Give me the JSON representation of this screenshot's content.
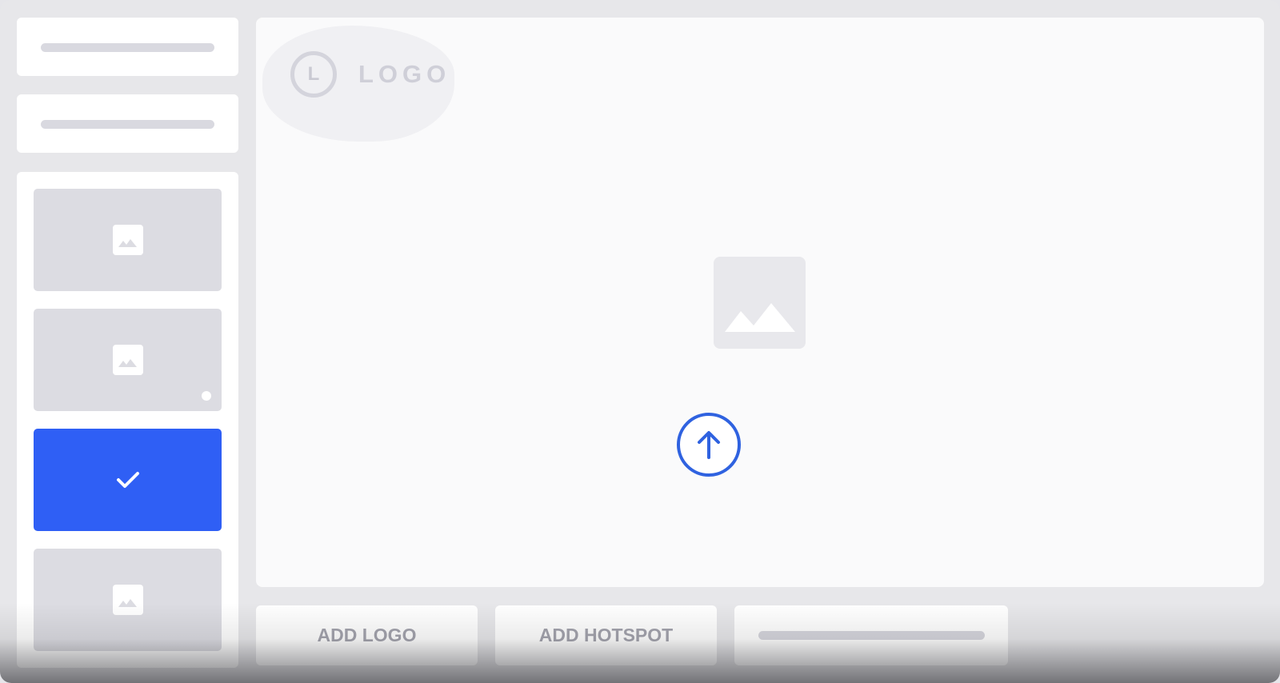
{
  "colors": {
    "background": "#e7e7ea",
    "panel": "#ffffff",
    "thumbnail": "#dcdce2",
    "selected": "#2f5ff5",
    "accent": "#2f62e0",
    "muted_text": "#a4a4ae"
  },
  "sidebar": {
    "cards": [
      {
        "icon": "placeholder-bar"
      },
      {
        "icon": "placeholder-bar"
      }
    ],
    "thumbnails": [
      {
        "icon": "image-icon",
        "selected": false,
        "indicator": false
      },
      {
        "icon": "image-icon",
        "selected": false,
        "indicator": true
      },
      {
        "icon": "check-icon",
        "selected": true,
        "indicator": false
      },
      {
        "icon": "image-icon",
        "selected": false,
        "indicator": false
      }
    ]
  },
  "canvas": {
    "logo": {
      "mark": "L",
      "text": "LOGO"
    },
    "center_icon": "image-icon",
    "upload_icon": "arrow-up-circle-icon"
  },
  "toolbar": {
    "add_logo_label": "ADD LOGO",
    "add_hotspot_label": "ADD HOTSPOT",
    "third_item": "placeholder-bar"
  }
}
